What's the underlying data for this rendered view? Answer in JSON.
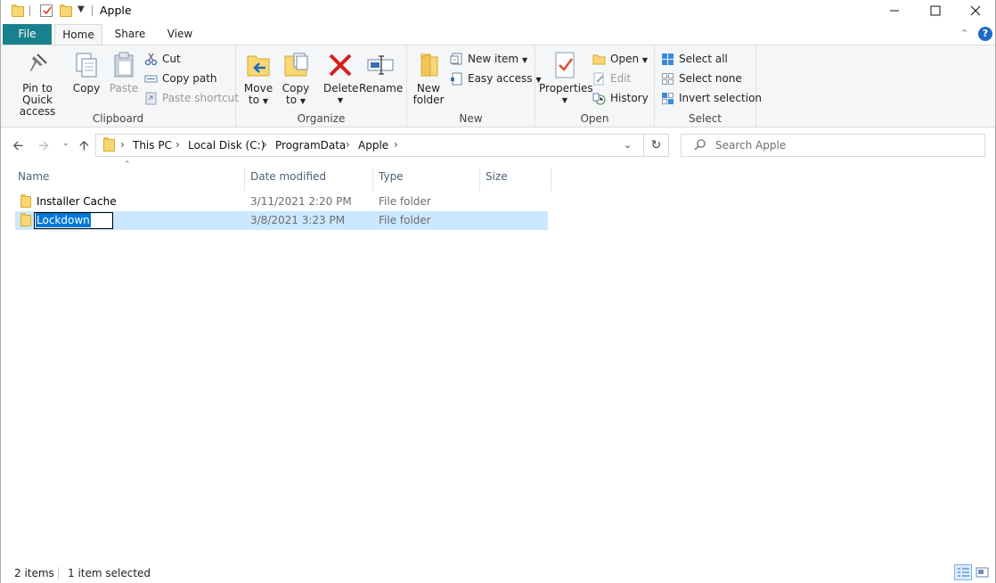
{
  "window": {
    "title": "Apple"
  },
  "tabs": [
    {
      "label": "File"
    },
    {
      "label": "Home"
    },
    {
      "label": "Share"
    },
    {
      "label": "View"
    }
  ],
  "ribbon": {
    "clipboard": {
      "pin_label_1": "Pin to Quick",
      "pin_label_2": "access",
      "copy": "Copy",
      "paste": "Paste",
      "cut": "Cut",
      "copy_path": "Copy path",
      "paste_shortcut": "Paste shortcut",
      "group": "Clipboard"
    },
    "organize": {
      "move_1": "Move",
      "move_2": "to",
      "copy_1": "Copy",
      "copy_2": "to",
      "delete": "Delete",
      "rename": "Rename",
      "group": "Organize"
    },
    "new": {
      "new_folder_1": "New",
      "new_folder_2": "folder",
      "new_item": "New item",
      "easy_access": "Easy access",
      "group": "New"
    },
    "open": {
      "properties": "Properties",
      "open": "Open",
      "edit": "Edit",
      "history": "History",
      "group": "Open"
    },
    "select": {
      "select_all": "Select all",
      "select_none": "Select none",
      "invert": "Invert selection",
      "group": "Select"
    }
  },
  "address": {
    "crumbs": [
      "This PC",
      "Local Disk (C:)",
      "ProgramData",
      "Apple"
    ]
  },
  "search": {
    "placeholder": "Search Apple"
  },
  "columns": [
    "Name",
    "Date modified",
    "Type",
    "Size"
  ],
  "files": [
    {
      "name": "Installer Cache",
      "date": "3/11/2021 2:20 PM",
      "type": "File folder",
      "size": ""
    },
    {
      "name": "Lockdown",
      "date": "3/8/2021 3:23 PM",
      "type": "File folder",
      "size": ""
    }
  ],
  "status": {
    "count": "2 items",
    "selected": "1 item selected"
  },
  "colors": {
    "file_tab": "#19818d",
    "selection": "#cce8ff",
    "rename_highlight": "#0078d7"
  }
}
